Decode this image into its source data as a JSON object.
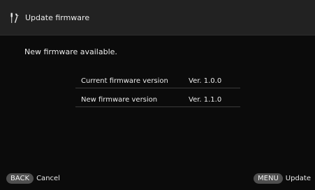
{
  "header": {
    "icon": "tools-icon",
    "title": "Update firmware"
  },
  "message": "New firmware available.",
  "firmware_info": [
    {
      "label": "Current firmware version",
      "value": "Ver. 1.0.0"
    },
    {
      "label": "New firmware version",
      "value": "Ver. 1.1.0"
    }
  ],
  "footer": {
    "back_key": "BACK",
    "back_label": "Cancel",
    "menu_key": "MENU",
    "menu_label": "Update"
  },
  "colors": {
    "background": "#0b0b0b",
    "header_background": "#222222",
    "badge_background": "#4f4f4f",
    "text": "#ececec"
  }
}
